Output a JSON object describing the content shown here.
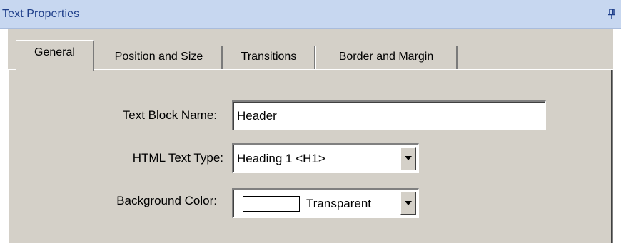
{
  "panel": {
    "title": "Text Properties",
    "pin_icon": "pin-icon"
  },
  "tabs": [
    {
      "label": "General",
      "active": true
    },
    {
      "label": "Position and Size",
      "active": false
    },
    {
      "label": "Transitions",
      "active": false
    },
    {
      "label": "Border and Margin",
      "active": false
    }
  ],
  "form": {
    "text_block_name": {
      "label": "Text Block Name:",
      "value": "Header"
    },
    "html_text_type": {
      "label": "HTML Text Type:",
      "value": "Heading 1 <H1>"
    },
    "background_color": {
      "label": "Background Color:",
      "value": "Transparent",
      "swatch_color": "#ffffff"
    }
  },
  "colors": {
    "titlebar": "#c7d7f0",
    "title_text": "#1f3f8a",
    "dialog_face": "#d4d0c8"
  }
}
